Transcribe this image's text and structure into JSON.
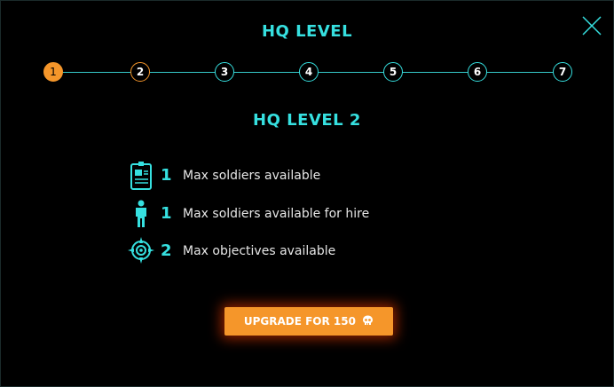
{
  "dialog": {
    "title": "HQ LEVEL",
    "close_icon": "close-icon"
  },
  "levels": {
    "steps": [
      "1",
      "2",
      "3",
      "4",
      "5",
      "6",
      "7"
    ],
    "current": 1,
    "selected": 2
  },
  "detail": {
    "subtitle": "HQ LEVEL 2",
    "stats": [
      {
        "icon": "id-badge-icon",
        "value": "1",
        "label": "Max soldiers available"
      },
      {
        "icon": "soldier-icon",
        "value": "1",
        "label": "Max soldiers available for hire"
      },
      {
        "icon": "crosshair-compass-icon",
        "value": "2",
        "label": "Max objectives available"
      }
    ]
  },
  "upgrade": {
    "label": "UPGRADE FOR 150",
    "currency_icon": "skull-icon"
  },
  "colors": {
    "accent": "#36e0e0",
    "highlight": "#f5962a",
    "background": "#000000",
    "text": "#e6e6e6"
  }
}
